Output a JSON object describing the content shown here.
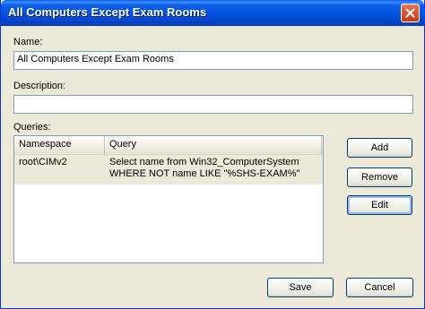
{
  "window": {
    "title": "All Computers Except Exam Rooms"
  },
  "name_field": {
    "label": "Name:",
    "value": "All Computers Except Exam Rooms"
  },
  "description_field": {
    "label": "Description:",
    "value": ""
  },
  "queries": {
    "label": "Queries:",
    "columns": [
      "Namespace",
      "Query"
    ],
    "rows": [
      {
        "namespace": "root\\CIMv2",
        "query_line1": "Select name from Win32_ComputerSystem",
        "query_line2": "WHERE NOT name LIKE \"%SHS-EXAM%\""
      }
    ]
  },
  "buttons": {
    "add": "Add",
    "remove": "Remove",
    "edit": "Edit",
    "save": "Save",
    "cancel": "Cancel"
  }
}
